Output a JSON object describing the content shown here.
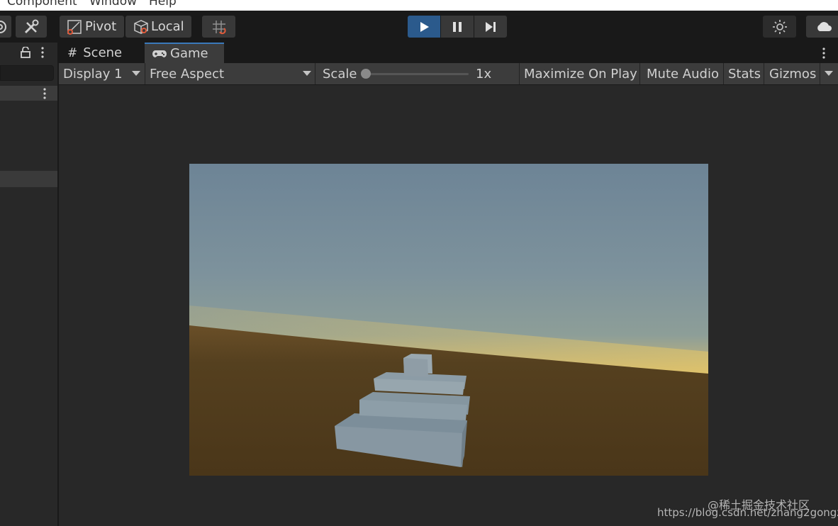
{
  "menu": {
    "items": [
      {
        "label": "Component"
      },
      {
        "label": "Window"
      },
      {
        "label": "Help"
      }
    ]
  },
  "toolbar": {
    "pivot_label": "Pivot",
    "local_label": "Local"
  },
  "tabs": [
    {
      "label": "Scene",
      "icon": "hash-icon",
      "active": false
    },
    {
      "label": "Game",
      "icon": "gamepad-icon",
      "active": true
    }
  ],
  "game_toolbar": {
    "display": "Display 1",
    "aspect": "Free Aspect",
    "scale_label": "Scale",
    "scale_value": "1x",
    "scale_fraction": 0,
    "maximize_label": "Maximize On Play",
    "mute_label": "Mute Audio",
    "stats_label": "Stats",
    "gizmos_label": "Gizmos"
  },
  "watermark": {
    "line1": "@稀土掘金技术社区",
    "line2": "https://blog.csdn.net/zhang2gongzi"
  },
  "colors": {
    "play_accent": "#2b5a8c",
    "tab_accent": "#3a79bb",
    "sky_top": "#6f8598",
    "horizon": "#d9b863",
    "ground": "#4e3a1f"
  }
}
